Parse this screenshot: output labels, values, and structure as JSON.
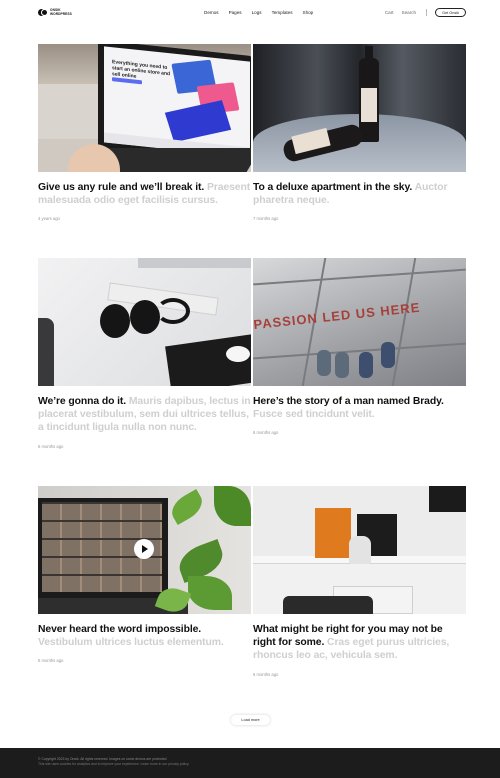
{
  "brand": {
    "logo_line1": "ONSIK",
    "logo_line2": "WORDPRESS"
  },
  "nav": [
    "Demos",
    "Pages",
    "Logs",
    "Templates",
    "Shop"
  ],
  "right_nav": {
    "cart": "Cart",
    "search": "Search",
    "button": "Get Onsik"
  },
  "posts": [
    {
      "title": "Give us any rule and we’ll break it.",
      "excerpt": "Praesent malesuada odio eget facilisis cursus.",
      "time": "4 years ago"
    },
    {
      "title": "To a deluxe apartment in the sky.",
      "excerpt": "Auctor pharetra neque.",
      "time": "7 months ago"
    },
    {
      "title": "We’re gonna do it.",
      "excerpt": "Mauris dapibus, lectus in placerat vestibulum, sem dui ultrices tellus, a tincidunt ligula nulla non nunc.",
      "time": "6 months ago"
    },
    {
      "title": "Here’s the story of a man named Brady.",
      "excerpt": "Fusce sed tincidunt velit.",
      "time": "6 months ago"
    },
    {
      "title": "Never heard the word impossible.",
      "excerpt": "Vestibulum ultrices luctus elementum.",
      "time": "6 months ago"
    },
    {
      "title": "What might be right for you may not be right for some.",
      "excerpt": "Cras eget purus ultricies, rhoncus leo ac, vehicula sem.",
      "time": "6 months ago"
    }
  ],
  "image_text": {
    "laptop_heading": "Everything you need to start an online store and sell online",
    "floor_text": "PASSION LED US HERE"
  },
  "load_more": "Load more",
  "footer": {
    "line1": "© Copyright 2023 by Onsik. All rights reserved. Images on some demos are protected.",
    "line2": "This site uses cookies for analytics and to improve your experience. Learn more in our privacy policy."
  },
  "colors": {
    "footer_bg": "#1c1c1c",
    "muted_text": "#cfcfcf",
    "accent_orange": "#e07a1e"
  }
}
